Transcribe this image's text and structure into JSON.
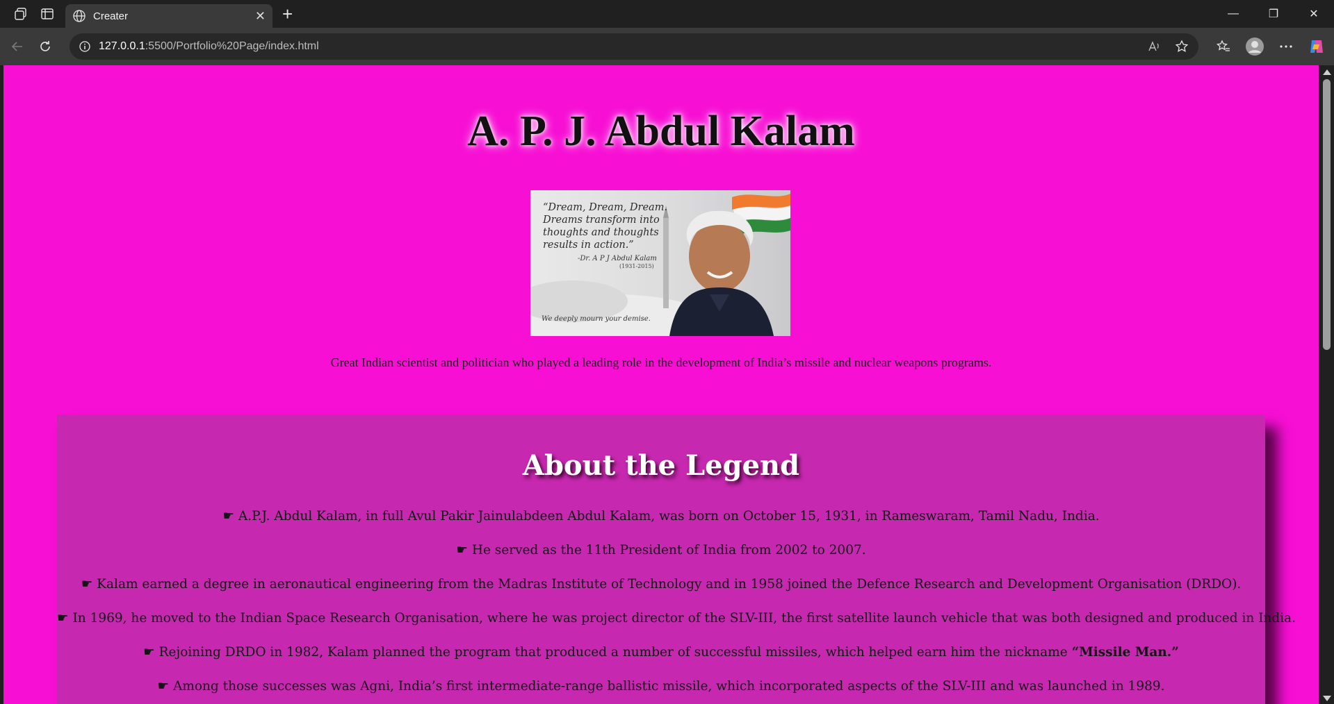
{
  "browser": {
    "tab_title": "Creater",
    "tab_close": "✕",
    "new_tab": "+",
    "url_host": "127.0.0.1",
    "url_path": ":5500/Portfolio%20Page/index.html",
    "window_controls": {
      "minimize": "—",
      "restore": "❐",
      "close": "✕"
    }
  },
  "page": {
    "background": "#f70fd4",
    "title": "A. P. J. Abdul Kalam",
    "portrait": {
      "quote": "“Dream, Dream, Dream. Dreams transform into thoughts and thoughts results in action.”",
      "attribution": "-Dr. A P J Abdul Kalam",
      "years": "(1931-2015)",
      "mourn": "We deeply mourn your demise."
    },
    "tagline": "Great Indian scientist and politician who played a leading role in the development of India’s missile and nuclear weapons programs.",
    "about": {
      "background": "#c728b0",
      "title": "About the Legend",
      "bullet": "☛",
      "facts": [
        "A.P.J. Abdul Kalam, in full Avul Pakir Jainulabdeen Abdul Kalam, was born on October 15, 1931, in Rameswaram, Tamil Nadu, India.",
        "He served as the 11th President of India from 2002 to 2007.",
        "Kalam earned a degree in aeronautical engineering from the Madras Institute of Technology and in 1958 joined the Defence Research and Development Organisation (DRDO).",
        "In 1969, he moved to the Indian Space Research Organisation, where he was project director of the SLV-III, the first satellite launch vehicle that was both designed and produced in India.",
        "Rejoining DRDO in 1982, Kalam planned the program that produced a number of successful missiles, which helped earn him the nickname",
        "Among those successes was Agni, India’s first intermediate-range ballistic missile, which incorporated aspects of the SLV-III and was launched in 1989."
      ],
      "nickname": "“Missile Man.”"
    }
  }
}
